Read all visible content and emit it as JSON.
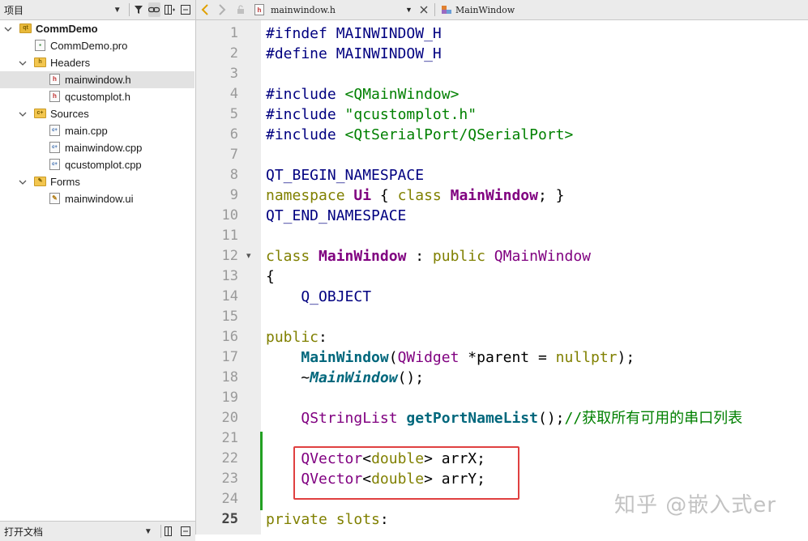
{
  "project_panel": {
    "title": "项目",
    "tree": [
      {
        "label": "CommDemo",
        "kind": "project"
      },
      {
        "label": "CommDemo.pro",
        "kind": "pro"
      },
      {
        "label": "Headers",
        "kind": "folder",
        "badge": "h"
      },
      {
        "label": "mainwindow.h",
        "kind": "header",
        "selected": true
      },
      {
        "label": "qcustomplot.h",
        "kind": "header"
      },
      {
        "label": "Sources",
        "kind": "folder",
        "badge": "c++"
      },
      {
        "label": "main.cpp",
        "kind": "source"
      },
      {
        "label": "mainwindow.cpp",
        "kind": "source"
      },
      {
        "label": "qcustomplot.cpp",
        "kind": "source"
      },
      {
        "label": "Forms",
        "kind": "folder",
        "badge": "ui"
      },
      {
        "label": "mainwindow.ui",
        "kind": "form"
      }
    ],
    "bottom_title": "打开文档"
  },
  "editor_toolbar": {
    "file_name": "mainwindow.h",
    "symbol": "MainWindow"
  },
  "editor": {
    "current_line": 25,
    "lines": [
      {
        "n": "1",
        "tokens": [
          [
            "#ifndef MAINWINDOW_H",
            "ns"
          ]
        ]
      },
      {
        "n": "2",
        "tokens": [
          [
            "#define MAINWINDOW_H",
            "ns"
          ]
        ]
      },
      {
        "n": "3",
        "tokens": []
      },
      {
        "n": "4",
        "tokens": [
          [
            "#include ",
            "ns"
          ],
          [
            "<QMainWindow>",
            "str"
          ]
        ]
      },
      {
        "n": "5",
        "tokens": [
          [
            "#include ",
            "ns"
          ],
          [
            "\"qcustomplot.h\"",
            "str"
          ]
        ]
      },
      {
        "n": "6",
        "tokens": [
          [
            "#include ",
            "ns"
          ],
          [
            "<QtSerialPort/QSerialPort>",
            "str"
          ]
        ]
      },
      {
        "n": "7",
        "tokens": []
      },
      {
        "n": "8",
        "tokens": [
          [
            "QT_BEGIN_NAMESPACE",
            "ns"
          ]
        ]
      },
      {
        "n": "9",
        "tokens": [
          [
            "namespace ",
            "kw"
          ],
          [
            "Ui",
            "typeb"
          ],
          [
            " { ",
            ""
          ],
          [
            "class ",
            "kw"
          ],
          [
            "MainWindow",
            "typeb"
          ],
          [
            "; }",
            ""
          ]
        ]
      },
      {
        "n": "10",
        "tokens": [
          [
            "QT_END_NAMESPACE",
            "ns"
          ]
        ]
      },
      {
        "n": "11",
        "tokens": []
      },
      {
        "n": "12",
        "tokens": [
          [
            "class ",
            "kw"
          ],
          [
            "MainWindow",
            "typeb"
          ],
          [
            " : ",
            ""
          ],
          [
            "public ",
            "kw"
          ],
          [
            "QMainWindow",
            "type"
          ]
        ],
        "fold": true
      },
      {
        "n": "13",
        "tokens": [
          [
            "{",
            ""
          ]
        ]
      },
      {
        "n": "14",
        "tokens": [
          [
            "    Q_OBJECT",
            "ns"
          ]
        ]
      },
      {
        "n": "15",
        "tokens": []
      },
      {
        "n": "16",
        "tokens": [
          [
            "public",
            "kw"
          ],
          [
            ":",
            ""
          ]
        ]
      },
      {
        "n": "17",
        "tokens": [
          [
            "    ",
            ""
          ],
          [
            "MainWindow",
            "func"
          ],
          [
            "(",
            ""
          ],
          [
            "QWidget",
            "type"
          ],
          [
            " *parent = ",
            ""
          ],
          [
            "nullptr",
            "kw"
          ],
          [
            ");",
            ""
          ]
        ]
      },
      {
        "n": "18",
        "tokens": [
          [
            "    ~",
            ""
          ],
          [
            "MainWindow",
            "funci"
          ],
          [
            "();",
            ""
          ]
        ]
      },
      {
        "n": "19",
        "tokens": []
      },
      {
        "n": "20",
        "tokens": [
          [
            "    ",
            ""
          ],
          [
            "QStringList",
            "type"
          ],
          [
            " ",
            ""
          ],
          [
            "getPortNameList",
            "func"
          ],
          [
            "();",
            ""
          ],
          [
            "//获取所有可用的串口列表",
            "cmt"
          ]
        ]
      },
      {
        "n": "21",
        "tokens": []
      },
      {
        "n": "22",
        "tokens": [
          [
            "    ",
            ""
          ],
          [
            "QVector",
            "type"
          ],
          [
            "<",
            ""
          ],
          [
            "double",
            "kw"
          ],
          [
            "> arrX;",
            ""
          ]
        ]
      },
      {
        "n": "23",
        "tokens": [
          [
            "    ",
            ""
          ],
          [
            "QVector",
            "type"
          ],
          [
            "<",
            ""
          ],
          [
            "double",
            "kw"
          ],
          [
            "> arrY;",
            ""
          ]
        ]
      },
      {
        "n": "24",
        "tokens": []
      },
      {
        "n": "25",
        "tokens": [
          [
            "private ",
            "kw"
          ],
          [
            "slots",
            "kw"
          ],
          [
            ":",
            ""
          ]
        ]
      }
    ]
  },
  "watermark": "知乎 @嵌入式er",
  "colors": {
    "keyword": "#808000",
    "type": "#800080",
    "function": "#00677c",
    "string": "#008000",
    "comment": "#008000",
    "preprocessor": "#000080",
    "highlight_box": "#e04040",
    "modified_marker": "#22a022"
  }
}
